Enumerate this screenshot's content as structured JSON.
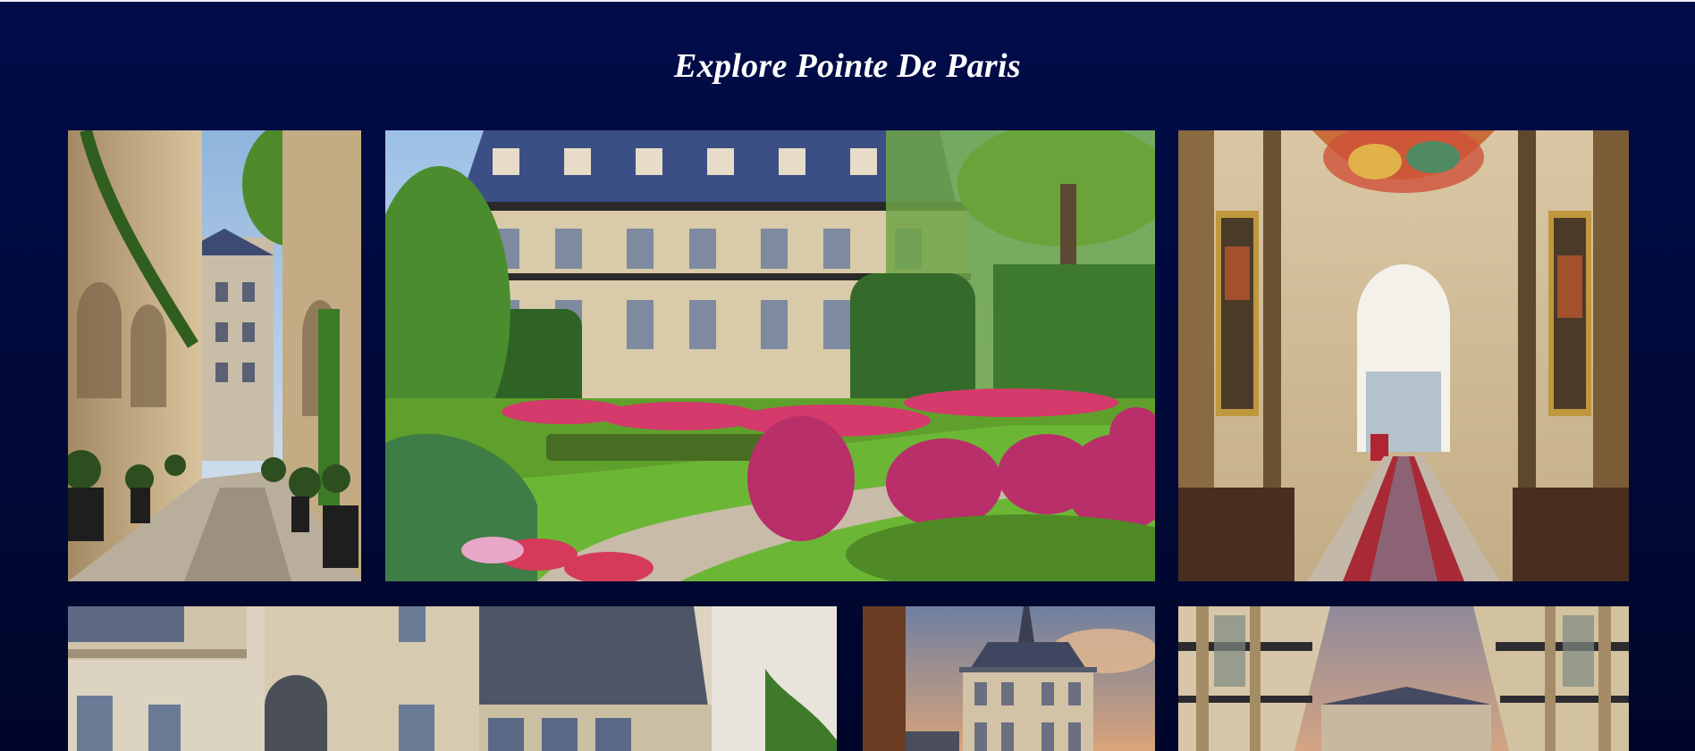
{
  "page": {
    "title": "Explore Pointe De Paris"
  },
  "gallery": {
    "tiles": [
      {
        "icon": "courtyard-passage-image"
      },
      {
        "icon": "garden-mansion-image"
      },
      {
        "icon": "gallery-hallway-image"
      },
      {
        "icon": "building-facade-image"
      },
      {
        "icon": "clock-tower-image"
      },
      {
        "icon": "arcade-passage-image"
      }
    ]
  },
  "colors": {
    "background": "#010c4a",
    "title": "#ffffff"
  }
}
